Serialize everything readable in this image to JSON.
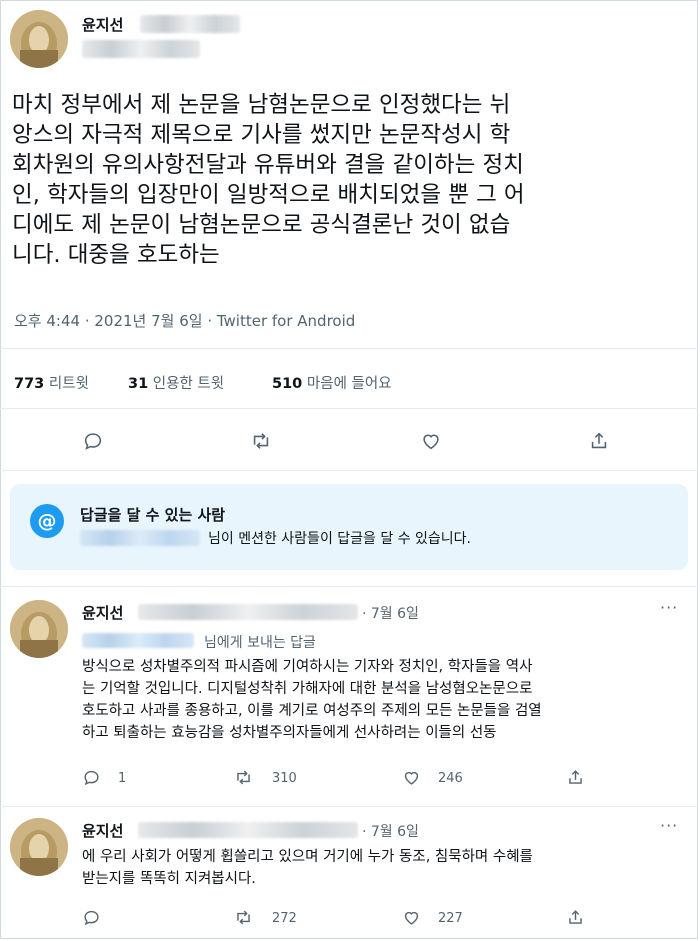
{
  "main_tweet": {
    "author_name": "윤지선",
    "lines": [
      "마치 정부에서 제 논문을 남혐논문으로 인정했다는 뉘",
      "앙스의 자극적  제목으로 기사를 썼지만 논문작성시 학",
      "회차원의 유의사항전달과 유튜버와 결을 같이하는 정치",
      "인, 학자들의 입장만이 일방적으로 배치되었을 뿐 그 어",
      "디에도 제 논문이 남혐논문으로 공식결론난 것이 없습",
      "니다. 대중을 호도하는"
    ],
    "timestamp": "오후 4:44 · 2021년 7월 6일 · Twitter for Android",
    "stats": {
      "retweets_count": "773",
      "retweets_label": "리트윗",
      "quotes_count": "31",
      "quotes_label": "인용한 트윗",
      "likes_count": "510",
      "likes_label": "마음에 들어요"
    }
  },
  "reply_notice": {
    "icon": "@",
    "title": "답글을 달 수 있는 사람",
    "subtitle": "님이 멘션한 사람들이 답글을 달 수 있습니다."
  },
  "reply1": {
    "author_name": "윤지선",
    "date": "· 7월 6일",
    "replying_to": "님에게 보내는 답글",
    "lines": [
      "방식으로 성차별주의적 파시즘에 기여하시는 기자와 정치인, 학자들을 역사",
      "는 기억할 것입니다. 디지털성착취 가해자에 대한 분석을 남성혐오논문으로",
      "호도하고 사과를 종용하고, 이를 계기로 여성주의 주제의 모든 논문들을 검열",
      "하고 퇴출하는 효능감을 성차별주의자들에게 선사하려는 이들의 선동"
    ],
    "reply_count": "1",
    "retweet_count": "310",
    "like_count": "246"
  },
  "reply2": {
    "author_name": "윤지선",
    "date": "· 7월 6일",
    "lines": [
      "에 우리 사회가 어떻게 휩쓸리고 있으며 거기에 누가 동조, 침묵하며 수혜를",
      "받는지를 똑똑히 지켜봅시다."
    ],
    "retweet_count": "272",
    "like_count": "227"
  }
}
